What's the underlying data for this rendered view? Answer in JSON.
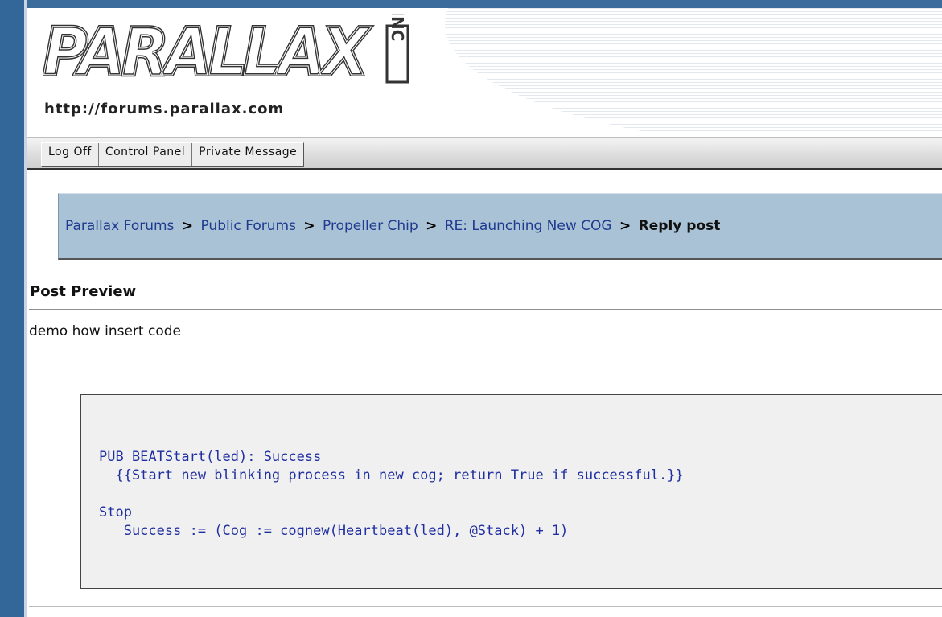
{
  "header": {
    "logo_text": "PARALLAX",
    "logo_suffix": "INC",
    "site_url": "http://forums.parallax.com"
  },
  "menu": {
    "items": [
      "Log Off",
      "Control Panel",
      "Private Message"
    ]
  },
  "breadcrumb": {
    "links": [
      "Parallax Forums",
      "Public Forums",
      "Propeller Chip",
      "RE: Launching New COG"
    ],
    "separator": ">",
    "current": "Reply post"
  },
  "preview": {
    "title": "Post Preview",
    "text": "demo how insert code",
    "code_lines": [
      "PUB BEATStart(led): Success",
      "  {{Start new blinking process in new cog; return True if successful.}}",
      "",
      "Stop",
      "   Success := (Cog := cognew(Heartbeat(led), @Stack) + 1)"
    ]
  },
  "colors": {
    "frame": "#336699",
    "breadcrumb_bg": "#a9c2d6",
    "link": "#1f3a8f",
    "code_text": "#1f2ea0"
  }
}
